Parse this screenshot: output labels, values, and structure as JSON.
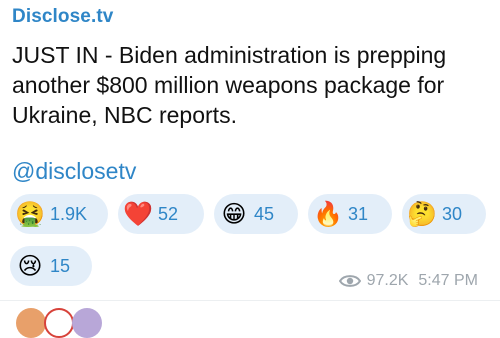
{
  "channel": {
    "name": "Disclose.tv"
  },
  "post": {
    "text": "JUST IN - Biden administration is prepping another $800 million weapons package for Ukraine, NBC reports.",
    "handle": "@disclosetv"
  },
  "reactions": [
    {
      "emoji": "🤮",
      "icon": "vomiting-face-icon",
      "count": "1.9K"
    },
    {
      "emoji": "❤️",
      "icon": "red-heart-icon",
      "count": "52"
    },
    {
      "emoji": "😁",
      "icon": "grinning-face-icon",
      "count": "45"
    },
    {
      "emoji": "🔥",
      "icon": "fire-icon",
      "count": "31"
    },
    {
      "emoji": "🤔",
      "icon": "thinking-face-icon",
      "count": "30"
    },
    {
      "emoji": "😢",
      "icon": "crying-face-icon",
      "count": "15"
    }
  ],
  "meta": {
    "views": "97.2K",
    "time": "5:47 PM",
    "icon": "eye-icon"
  },
  "colors": {
    "accent": "#2f86c7",
    "reaction_bg": "#e3eef9",
    "meta_gray": "#9ea6ad",
    "text": "#111111"
  }
}
